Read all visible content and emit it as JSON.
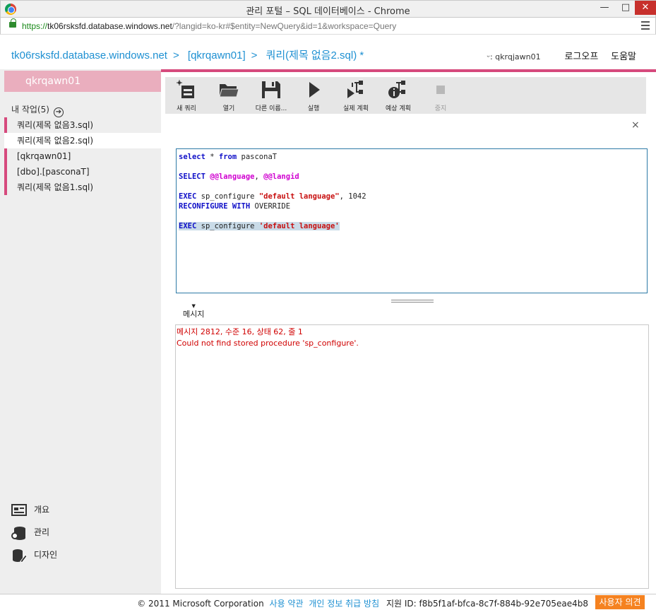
{
  "window": {
    "title": "관리 포털 – SQL 데이터베이스 - Chrome",
    "minimize": "—",
    "maximize": "□",
    "close": "✕"
  },
  "address": {
    "scheme": "https://",
    "host": "tk06rsksfd.database.windows.net",
    "path": "/?langid=ko-kr#$entity=NewQuery&id=1&workspace=Query"
  },
  "header": {
    "breadcrumb": [
      "tk06rsksfd.database.windows.net",
      "[qkrqawn01]",
      "쿼리(제목 없음2.sql) *"
    ],
    "separator": ">",
    "user": "ᵕ: qkrqjawn01",
    "logout": "로그오프",
    "help": "도움말"
  },
  "sidebar": {
    "account": "qkrqawn01",
    "tasks_title": "내 작업(5)",
    "tasks_arrow": "➔",
    "tasks": [
      {
        "label": "쿼리(제목 없음3.sql)"
      },
      {
        "label": "쿼리(제목 없음2.sql)"
      },
      {
        "label": "[qkrqawn01]"
      },
      {
        "label": "[dbo].[pasconaT]"
      },
      {
        "label": "쿼리(제목 없음1.sql)"
      }
    ],
    "nav": [
      {
        "label": "개요",
        "icon": "overview-icon"
      },
      {
        "label": "관리",
        "icon": "database-admin-icon"
      },
      {
        "label": "디자인",
        "icon": "design-icon"
      }
    ]
  },
  "toolbar": {
    "new_query": "새 쿼리",
    "open": "열기",
    "save_as": "다른 이름...",
    "run": "실행",
    "actual_plan": "실제 계획",
    "estimated_plan": "예상 계획",
    "stop": "중지",
    "close": "×"
  },
  "editor": {
    "lines": [
      {
        "t1": "select",
        "t2": " * ",
        "t3": "from",
        "t4": " pasconaT"
      },
      {},
      {
        "t1": "SELECT",
        "t2": " ",
        "t3": "@@language",
        "t4": ", ",
        "t5": "@@langid"
      },
      {},
      {
        "t1": "EXEC",
        "t2": " sp_configure ",
        "t3": "\"default language\"",
        "t4": ", 1042"
      },
      {
        "t1": "RECONFIGURE",
        "t2": " ",
        "t3": "WITH",
        "t4": " OVERRIDE"
      },
      {},
      {
        "t1": "EXEC",
        "t2": " sp_configure ",
        "t3": "'default language'"
      }
    ]
  },
  "results": {
    "tab_label": "메시지",
    "caret": "▼",
    "messages": [
      "메시지 2812, 수준 16, 상태 62, 줄 1",
      "Could not find stored procedure 'sp_configure'."
    ]
  },
  "footer": {
    "copyright": "© 2011 Microsoft Corporation",
    "terms": "사용 약관",
    "privacy": "개인 정보 취급 방침",
    "support_id": "지원 ID: f8b5f1af-bfca-8c7f-884b-92e705eae4b8",
    "feedback": "사용자 의견"
  },
  "colors": {
    "accent_pink": "#d64a7d",
    "account_bg": "#eaaebe",
    "link_blue": "#1e90d2",
    "keyword": "#1010c8",
    "string": "#c81010",
    "error": "#d00000",
    "feedback_orange": "#f58220"
  }
}
